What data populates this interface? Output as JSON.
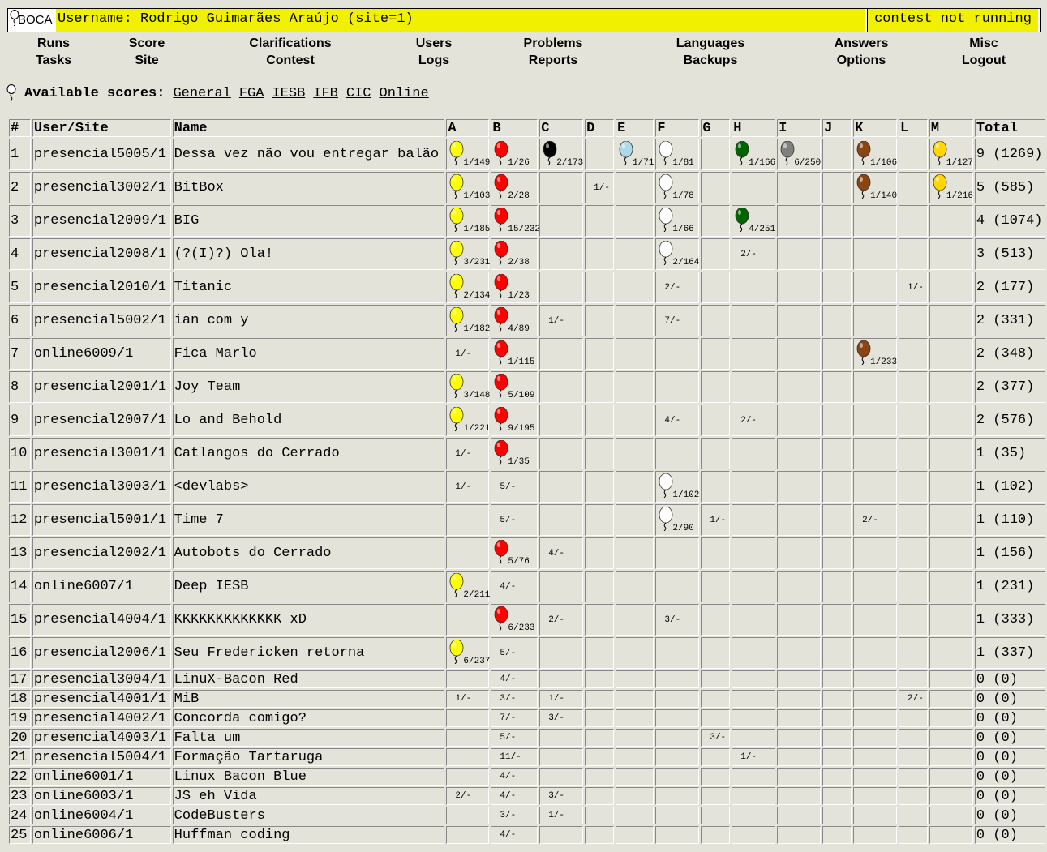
{
  "app": {
    "logo_text": "BOCA",
    "user_label": "Username: Rodrigo Guimarães Araújo (site=1)",
    "status": "contest not running"
  },
  "menu": [
    [
      "Runs",
      "Tasks"
    ],
    [
      "Score",
      "Site"
    ],
    [
      "Clarifications",
      "Contest"
    ],
    [
      "Users",
      "Logs"
    ],
    [
      "Problems",
      "Reports"
    ],
    [
      "Languages",
      "Backups"
    ],
    [
      "Answers",
      "Options"
    ],
    [
      "Misc",
      "Logout"
    ]
  ],
  "scores": {
    "label": "Available scores:",
    "links": [
      "General",
      "FGA",
      "IESB",
      "IFB",
      "CIC",
      "Online"
    ]
  },
  "table": {
    "headers": [
      "#",
      "User/Site",
      "Name",
      "A",
      "B",
      "C",
      "D",
      "E",
      "F",
      "G",
      "H",
      "I",
      "J",
      "K",
      "L",
      "M",
      "Total"
    ],
    "problem_colors": {
      "A": "#ffff00",
      "B": "#ff0000",
      "C": "#000000",
      "D": "#ffffff",
      "E": "#add8e6",
      "F": "#ffffff",
      "G": "#ffffff",
      "H": "#006400",
      "I": "#808080",
      "J": "#ffffff",
      "K": "#8b4513",
      "L": "#ffffff",
      "M": "#ffd700"
    },
    "rows": [
      {
        "rank": "1",
        "user": "presencial5005/1",
        "name": "Dessa vez não vou entregar balão",
        "cells": {
          "A": "1/149*",
          "B": "1/26*",
          "C": "2/173*",
          "E": "1/71*",
          "F": "1/81*",
          "H": "1/166*",
          "I": "6/250*",
          "K": "1/106*",
          "M": "1/127*"
        },
        "total": "9 (1269)"
      },
      {
        "rank": "2",
        "user": "presencial3002/1",
        "name": "BitBox",
        "cells": {
          "A": "1/103*",
          "B": "2/28*",
          "D": "1/-",
          "F": "1/78*",
          "K": "1/140*",
          "M": "1/216*"
        },
        "total": "5 (585)"
      },
      {
        "rank": "3",
        "user": "presencial2009/1",
        "name": "BIG",
        "cells": {
          "A": "1/185*",
          "B": "15/232*",
          "F": "1/66*",
          "H": "4/251*"
        },
        "total": "4 (1074)"
      },
      {
        "rank": "4",
        "user": "presencial2008/1",
        "name": "(?(I)?) Ola!",
        "cells": {
          "A": "3/231*",
          "B": "2/38*",
          "F": "2/164*",
          "H": "2/-"
        },
        "total": "3 (513)"
      },
      {
        "rank": "5",
        "user": "presencial2010/1",
        "name": "Titanic",
        "cells": {
          "A": "2/134*",
          "B": "1/23*",
          "F": "2/-",
          "L": "1/-"
        },
        "total": "2 (177)"
      },
      {
        "rank": "6",
        "user": "presencial5002/1",
        "name": "ian com y",
        "cells": {
          "A": "1/182*",
          "B": "4/89*",
          "C": "1/-",
          "F": "7/-"
        },
        "total": "2 (331)"
      },
      {
        "rank": "7",
        "user": "online6009/1",
        "name": "Fica Marlo",
        "cells": {
          "A": "1/-",
          "B": "1/115*",
          "K": "1/233*"
        },
        "total": "2 (348)"
      },
      {
        "rank": "8",
        "user": "presencial2001/1",
        "name": "Joy Team",
        "cells": {
          "A": "3/148*",
          "B": "5/109*"
        },
        "total": "2 (377)"
      },
      {
        "rank": "9",
        "user": "presencial2007/1",
        "name": "Lo and Behold",
        "cells": {
          "A": "1/221*",
          "B": "9/195*",
          "F": "4/-",
          "H": "2/-"
        },
        "total": "2 (576)"
      },
      {
        "rank": "10",
        "user": "presencial3001/1",
        "name": "Catlangos do Cerrado",
        "cells": {
          "A": "1/-",
          "B": "1/35*"
        },
        "total": "1 (35)"
      },
      {
        "rank": "11",
        "user": "presencial3003/1",
        "name": "<devlabs>",
        "cells": {
          "A": "1/-",
          "B": "5/-",
          "F": "1/102*"
        },
        "total": "1 (102)"
      },
      {
        "rank": "12",
        "user": "presencial5001/1",
        "name": "Time 7",
        "cells": {
          "B": "5/-",
          "F": "2/90*",
          "G": "1/-",
          "K": "2/-"
        },
        "total": "1 (110)"
      },
      {
        "rank": "13",
        "user": "presencial2002/1",
        "name": "Autobots do Cerrado",
        "cells": {
          "B": "5/76*",
          "C": "4/-"
        },
        "total": "1 (156)"
      },
      {
        "rank": "14",
        "user": "online6007/1",
        "name": "Deep IESB",
        "cells": {
          "A": "2/211*",
          "B": "4/-"
        },
        "total": "1 (231)"
      },
      {
        "rank": "15",
        "user": "presencial4004/1",
        "name": "KKKKKKKKKKKKK xD",
        "cells": {
          "B": "6/233*",
          "C": "2/-",
          "F": "3/-"
        },
        "total": "1 (333)"
      },
      {
        "rank": "16",
        "user": "presencial2006/1",
        "name": "Seu Fredericken retorna",
        "cells": {
          "A": "6/237*",
          "B": "5/-"
        },
        "total": "1 (337)"
      },
      {
        "rank": "17",
        "user": "presencial3004/1",
        "name": "LinuX-Bacon Red",
        "cells": {
          "B": "4/-"
        },
        "total": "0 (0)"
      },
      {
        "rank": "18",
        "user": "presencial4001/1",
        "name": "MiB",
        "cells": {
          "A": "1/-",
          "B": "3/-",
          "C": "1/-",
          "L": "2/-"
        },
        "total": "0 (0)"
      },
      {
        "rank": "19",
        "user": "presencial4002/1",
        "name": "Concorda comigo?",
        "cells": {
          "B": "7/-",
          "C": "3/-"
        },
        "total": "0 (0)"
      },
      {
        "rank": "20",
        "user": "presencial4003/1",
        "name": "Falta um",
        "cells": {
          "B": "5/-",
          "G": "3/-"
        },
        "total": "0 (0)"
      },
      {
        "rank": "21",
        "user": "presencial5004/1",
        "name": "Formação Tartaruga",
        "cells": {
          "B": "11/-",
          "H": "1/-"
        },
        "total": "0 (0)"
      },
      {
        "rank": "22",
        "user": "online6001/1",
        "name": "Linux Bacon Blue",
        "cells": {
          "B": "4/-"
        },
        "total": "0 (0)"
      },
      {
        "rank": "23",
        "user": "online6003/1",
        "name": "JS eh Vida",
        "cells": {
          "A": "2/-",
          "B": "4/-",
          "C": "3/-"
        },
        "total": "0 (0)"
      },
      {
        "rank": "24",
        "user": "online6004/1",
        "name": "CodeBusters",
        "cells": {
          "B": "3/-",
          "C": "1/-"
        },
        "total": "0 (0)"
      },
      {
        "rank": "25",
        "user": "online6006/1",
        "name": "Huffman coding",
        "cells": {
          "B": "4/-"
        },
        "total": "0 (0)"
      }
    ]
  }
}
